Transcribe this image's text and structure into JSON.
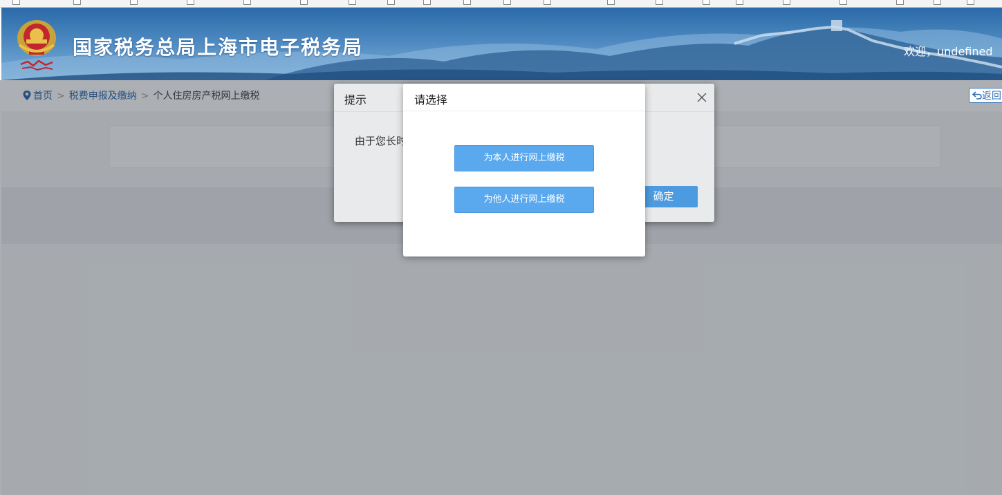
{
  "header": {
    "site_title": "国家税务总局上海市电子税务局",
    "welcome": "欢迎，undefined",
    "separator": "|"
  },
  "breadcrumb": {
    "home": "首页",
    "level2": "税费申报及缴纳",
    "current": "个人住房房产税网上缴税",
    "separator": ">"
  },
  "back_button": {
    "label": "返回"
  },
  "prompt_dialog": {
    "title": "提示",
    "message": "由于您长时",
    "ok_label": "确定"
  },
  "choice_dialog": {
    "title": "请选择",
    "option_self": "为本人进行网上缴税",
    "option_other": "为他人进行网上缴税"
  },
  "colors": {
    "banner": "#3a78b4",
    "primary_button": "#5aa8ee",
    "ok_button": "#4c9be0",
    "link": "#1f5fa8"
  }
}
